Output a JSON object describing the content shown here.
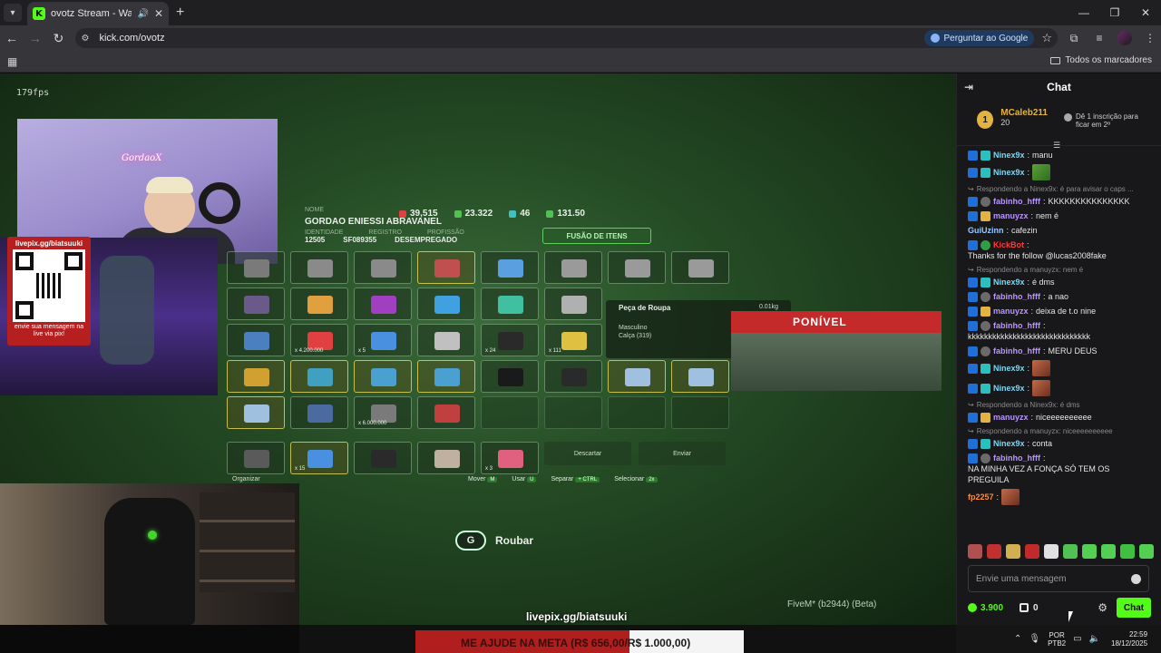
{
  "browser": {
    "tab_title": "ovotz Stream - Watch Live o",
    "url": "kick.com/ovotz",
    "ask_google": "Perguntar ao Google",
    "all_bookmarks": "Todos os marcadores"
  },
  "stream": {
    "fps": "179fps",
    "webcam_sign": "GordaoX",
    "qr_title": "livepix.gg/biatsuuki",
    "qr_caption": "envie sua mensagem na live via pix!",
    "livepix_url": "livepix.gg/biatsuuki",
    "fivem": "FiveM* (b2944) (Beta)",
    "roubar_key": "G",
    "roubar": "Roubar"
  },
  "character": {
    "nome_label": "NOME",
    "name": "GORDAO ENIESSI ABRAVANEL",
    "identidade_label": "IDENTIDADE",
    "registro_label": "REGISTRO",
    "profissao_label": "PROFISSÃO",
    "identidade": "12505",
    "registro": "SF089355",
    "profissao": "DESEMPREGADO",
    "stats": [
      "39,515",
      "23.322",
      "46",
      "131.50"
    ],
    "fusao": "FUSÃO DE ITENS"
  },
  "tooltip": {
    "title": "Peça de Roupa",
    "weight": "0.01kg",
    "row1": "Masculino",
    "row2": "Calça (319)"
  },
  "banner": "PONÍVEL",
  "inventory": {
    "organizar": "Organizar",
    "descartar": "Descartar",
    "enviar": "Enviar",
    "hints": [
      {
        "label": "Mover",
        "key": "M"
      },
      {
        "label": "Usar",
        "key": "U"
      },
      {
        "label": "Separar",
        "key": "+ CTRL"
      },
      {
        "label": "Selecionar",
        "key": "2x"
      }
    ],
    "qty": [
      "x 4.200.000",
      "x 5",
      "x 24",
      "x 111",
      "x 6.000.000",
      "x 15",
      "x 3"
    ]
  },
  "meta": {
    "text": "ME AJUDE NA META (R$ 656,00/",
    "goal": "R$ 1.000,00)"
  },
  "chat": {
    "title": "Chat",
    "leader_name": "MCaleb211",
    "leader_count": "20",
    "leader_rank": "1",
    "leader_cta": "Dê 1 inscrição para ficar em 2º",
    "messages": [
      {
        "user": "Ninex9x",
        "text": "manu"
      },
      {
        "user": "Ninex9x",
        "text": ""
      },
      {
        "reply": "Respondendo a Ninex9x: é para avisar o caps ..."
      },
      {
        "user": "fabinho_hfff",
        "text": "KKKKKKKKKKKKKKK"
      },
      {
        "user": "manuyzx",
        "text": "nem é"
      },
      {
        "user": "GuiUzinn",
        "text": "cafezin"
      },
      {
        "user": "KickBot",
        "text": "Thanks for the follow @lucas2008fake"
      },
      {
        "reply": "Respondendo a manuyzx: nem é"
      },
      {
        "user": "Ninex9x",
        "text": "é dms"
      },
      {
        "user": "fabinho_hfff",
        "text": "a nao"
      },
      {
        "user": "manuyzx",
        "text": "deixa de t.o nine"
      },
      {
        "user": "fabinho_hfff",
        "text": "kkkkkkkkkkkkkkkkkkkkkkkkkkkkkk"
      },
      {
        "user": "fabinho_hfff",
        "text": "MERU DEUS"
      },
      {
        "user": "Ninex9x",
        "text": ""
      },
      {
        "user": "Ninex9x",
        "text": ""
      },
      {
        "reply": "Respondendo a Ninex9x: é dms"
      },
      {
        "user": "manuyzx",
        "text": "niceeeeeeeeee"
      },
      {
        "reply": "Respondendo a manuyzx: niceeeeeeeeee"
      },
      {
        "user": "Ninex9x",
        "text": "conta"
      },
      {
        "user": "fabinho_hfff",
        "text": "NA MINHA VEZ A FONÇA SÓ TEM OS PREGUILA"
      },
      {
        "user": "fp2257",
        "text": ""
      }
    ],
    "input_placeholder": "Envie uma mensagem",
    "points": "3.900",
    "gifts": "0",
    "send": "Chat"
  },
  "taskbar": {
    "lang1": "POR",
    "lang2": "PTB2",
    "time": "22:59",
    "date": "18/12/2025"
  },
  "colors": {
    "kick_green": "#53fc18",
    "banner_red": "#c42a2a"
  }
}
